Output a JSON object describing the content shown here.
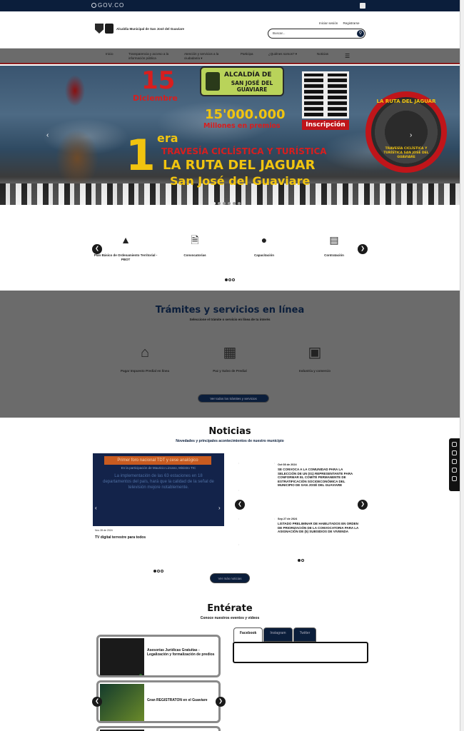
{
  "govbar": {
    "logo": "GOV.CO"
  },
  "header": {
    "brand_name": "Alcaldía Municipal de San José del Guaviare",
    "login": "Iniciar sesión",
    "register": "Registrarse",
    "search_placeholder": "Buscar..."
  },
  "nav": {
    "items": [
      "Inicio",
      "Transparencia y acceso a la información pública",
      "Atención y servicios a la ciudadanía",
      "Participa",
      "¿Quiénes somos?",
      "Noticias"
    ]
  },
  "hero": {
    "date_day": "15",
    "date_month": "Diciembre",
    "alcaldia_line1": "ALCALDÍA DE",
    "alcaldia_line2": "SAN JOSÉ DEL GUAVIARE",
    "prize_amount": "15'000.000",
    "prize_caption": "Millones en premios",
    "inscripcion": "Inscripción",
    "edition_number": "1",
    "edition_suffix": "era",
    "line1": "TRAVESÍA CICLÍSTICA Y TURÍSTICA",
    "line2": "LA RUTA DEL JAGUAR",
    "line3": "San José del Guaviare",
    "emblem_top": "LA RUTA DEL JAGUAR",
    "emblem_bottom": "TRAVESÍA CICLÍSTICA Y TURÍSTICA SAN JOSÉ DEL GUAVIARE"
  },
  "quick_links": [
    {
      "label": "Plan Básico de Ordenamiento Territorial - PBOT",
      "icon": "road-icon"
    },
    {
      "label": "Convocatorias",
      "icon": "document-icon"
    },
    {
      "label": "Capacitación",
      "icon": "person-icon"
    },
    {
      "label": "Contratación",
      "icon": "contract-icon"
    }
  ],
  "tramites": {
    "title": "Trámites y servicios en línea",
    "subtitle": "Seleccione el trámite o servicio en línea de tu interés",
    "items": [
      {
        "label": "Pagar Impuesto Predial en línea",
        "icon": "house-icon"
      },
      {
        "label": "Paz y Salvo de Predial",
        "icon": "calculator-icon"
      },
      {
        "label": "Industria y comercio",
        "icon": "store-icon"
      }
    ],
    "more_button": "Ver todos los trámites y servicios"
  },
  "noticias": {
    "title": "Noticias",
    "subtitle": "Novedades y principales acontecimientos de nuestro municipio",
    "featured": {
      "banner": "Primer foro nacional TDT y cese analógico",
      "kicker": "En la participación de Mauricio Lizcano, Ministro TIC",
      "body": "La implementación de las 63 estaciones en 18 departamentos del país, hará que la calidad de la señal de televisión mejore notablemente.",
      "date": "Nov 28 de 2024",
      "caption": "TV digital terrestre para todos"
    },
    "list": [
      {
        "date": "Oct 08 de 2024",
        "title": "SE CONVOCA A LA COMUNIDAD PARA LA SELECCIÓN DE UN (01) REPRESENTANTE PARA CONFORMAR EL COMITÉ PERMANENTE DE ESTRATIFICACIÓN SOCIOECONÓMICA DEL MUNICIPIO DE SAN JOSÉ DEL GUAVIARE"
      },
      {
        "date": "Sep 27 de 2024",
        "title": "LISTADO PRELIMINAR DE HABILITADOS EN ORDEN DE PRIORIZACIÓN DE LA CONVOCATORIA PARA LA ASIGNACIÓN DE (5) SUBSIDIOS DE VIVIENDA"
      }
    ],
    "more_button": "Ver más noticias"
  },
  "enterate": {
    "title": "Entérate",
    "subtitle": "Conoce nuestros eventos y videos",
    "events": [
      {
        "label": "Asesorías Jurídicas Gratuitas - Legalización y formalización de predios"
      },
      {
        "label": "Gran REGISTRATON en el Guaviare"
      }
    ],
    "tabs": [
      "Facebook",
      "Instagram",
      "Twitter"
    ]
  }
}
